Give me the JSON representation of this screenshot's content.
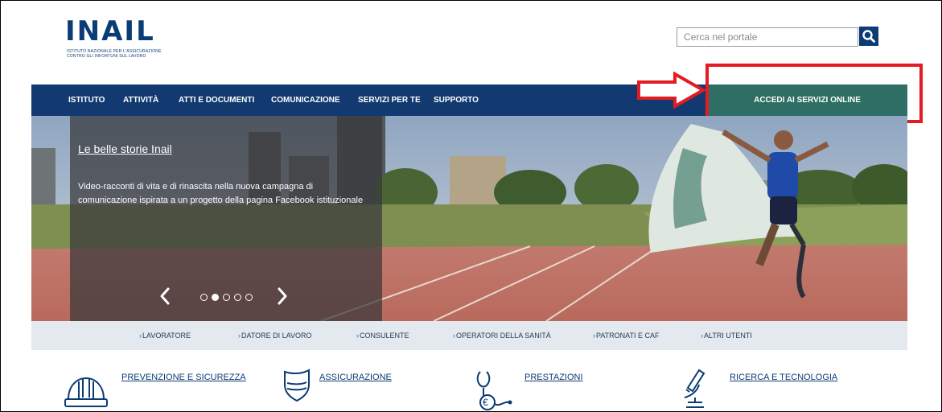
{
  "header": {
    "logo_text": "INAIL",
    "logo_subtitle_line1": "ISTITUTO NAZIONALE PER L'ASSICURAZIONE",
    "logo_subtitle_line2": "CONTRO GLI INFORTUNI SUL LAVORO",
    "search": {
      "placeholder": "Cerca nel portale",
      "button_icon": "search-icon"
    }
  },
  "nav": {
    "items": [
      "ISTITUTO",
      "ATTIVITÀ",
      "ATTI E DOCUMENTI",
      "COMUNICAZIONE",
      "SERVIZI PER TE",
      "SUPPORTO"
    ],
    "cta_label": "ACCEDI AI SERVIZI ONLINE"
  },
  "annotation": {
    "highlight_color": "#e31b23",
    "arrow_icon": "right-arrow-outline"
  },
  "hero": {
    "title": "Le belle storie Inail",
    "text": "Video-racconti di vita e di rinascita nella nuova campagna di comunicazione ispirata a un progetto della pagina Facebook istituzionale",
    "slide_count": 5,
    "active_slide": 2,
    "prev_icon": "chevron-left-icon",
    "next_icon": "chevron-right-icon"
  },
  "audience": {
    "items": [
      "LAVORATORE",
      "DATORE DI LAVORO",
      "CONSULENTE",
      "OPERATORI DELLA SANITÀ",
      "PATRONATI E CAF",
      "ALTRI UTENTI"
    ]
  },
  "categories": [
    {
      "label": "PREVENZIONE E SICUREZZA",
      "icon": "hard-hat-icon"
    },
    {
      "label": "ASSICURAZIONE",
      "icon": "shield-icon"
    },
    {
      "label": "PRESTAZIONI",
      "icon": "stethoscope-euro-icon"
    },
    {
      "label": "RICERCA E TECNOLOGIA",
      "icon": "microscope-icon"
    }
  ],
  "colors": {
    "brand_blue": "#0b3c75",
    "nav_bg": "#123a70",
    "cta_bg": "#2e6e64",
    "audience_bg": "#e4e9ef"
  }
}
